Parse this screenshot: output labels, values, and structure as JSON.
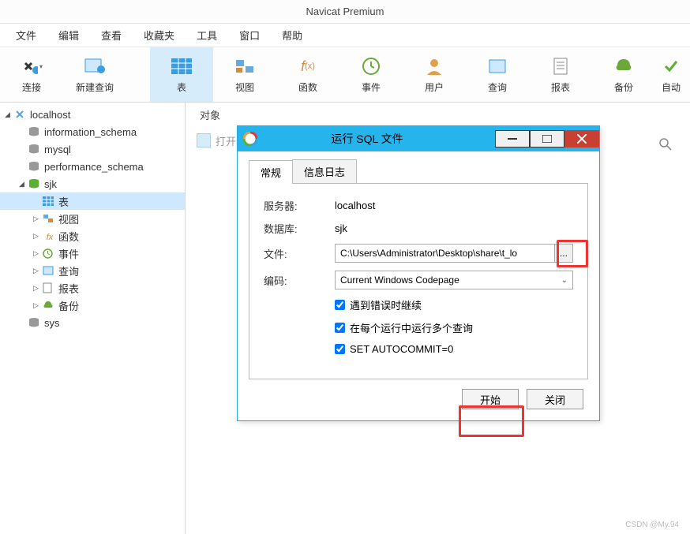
{
  "app_title": "Navicat Premium",
  "menu": [
    "文件",
    "编辑",
    "查看",
    "收藏夹",
    "工具",
    "窗口",
    "帮助"
  ],
  "toolbar": [
    {
      "label": "连接",
      "icon": "plug"
    },
    {
      "label": "新建查询",
      "icon": "newquery"
    },
    {
      "label": "表",
      "icon": "table",
      "active": true
    },
    {
      "label": "视图",
      "icon": "view"
    },
    {
      "label": "函数",
      "icon": "function"
    },
    {
      "label": "事件",
      "icon": "event"
    },
    {
      "label": "用户",
      "icon": "user"
    },
    {
      "label": "查询",
      "icon": "query"
    },
    {
      "label": "报表",
      "icon": "report"
    },
    {
      "label": "备份",
      "icon": "backup"
    },
    {
      "label": "自动",
      "icon": "auto"
    }
  ],
  "tree": {
    "conn": "localhost",
    "dbs": [
      "information_schema",
      "mysql",
      "performance_schema"
    ],
    "active_db": "sjk",
    "children": [
      {
        "label": "表",
        "icon": "table",
        "selected": true
      },
      {
        "label": "视图",
        "icon": "view"
      },
      {
        "label": "函数",
        "icon": "function"
      },
      {
        "label": "事件",
        "icon": "event"
      },
      {
        "label": "查询",
        "icon": "query"
      },
      {
        "label": "报表",
        "icon": "report"
      },
      {
        "label": "备份",
        "icon": "backup"
      }
    ],
    "other_db": "sys"
  },
  "content": {
    "tab": "对象",
    "subbar": "打开表"
  },
  "dialog": {
    "title": "运行 SQL 文件",
    "tabs": [
      "常规",
      "信息日志"
    ],
    "active_tab": 0,
    "fields": {
      "server_label": "服务器:",
      "server_value": "localhost",
      "db_label": "数据库:",
      "db_value": "sjk",
      "file_label": "文件:",
      "file_value": "C:\\Users\\Administrator\\Desktop\\share\\t_lo",
      "file_btn": "...",
      "enc_label": "编码:",
      "enc_value": "Current Windows Codepage"
    },
    "checks": [
      {
        "label": "遇到错误时继续",
        "checked": true
      },
      {
        "label": "在每个运行中运行多个查询",
        "checked": true
      },
      {
        "label": "SET AUTOCOMMIT=0",
        "checked": true
      }
    ],
    "buttons": {
      "start": "开始",
      "close": "关闭"
    }
  },
  "watermark": "CSDN @My.94"
}
